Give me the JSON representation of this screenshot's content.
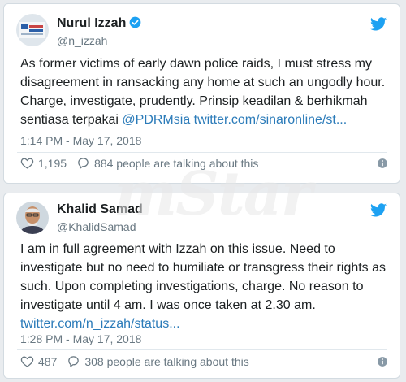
{
  "watermark": "mStar",
  "tweets": [
    {
      "name": "Nurul Izzah",
      "handle": "@n_izzah",
      "lines": [
        "As former victims of early dawn police raids, I must stress my",
        "disagreement in ransacking any home at such an ungodly hour.",
        "Charge, investigate, prudently. Prinsip keadilan & berhikmah"
      ],
      "line4_text": "sentiasa terpakai ",
      "line4_mention": "@PDRMsia",
      "line4_link": " twitter.com/sinaronline/st...",
      "time": "1:14 PM - May 17, 2018",
      "likes": "1,195",
      "talking": "884 people are talking about this"
    },
    {
      "name": "Khalid Samad",
      "handle": "@KhalidSamad",
      "lines": [
        "I am in full agreement with Izzah on this issue. Need to",
        "investigate but no need to humiliate or transgress their rights as",
        "such. Upon completing investigations, charge. No reason to",
        "investigate until 4 am. I was once taken at 2.30 am."
      ],
      "link": "twitter.com/n_izzah/status...",
      "time": "1:28 PM - May 17, 2018",
      "likes": "487",
      "talking": "308 people are talking about this"
    }
  ],
  "colors": {
    "twitter_blue": "#1da1f2",
    "link": "#2b7bb9",
    "text": "#1c2022",
    "muted": "#697882"
  }
}
